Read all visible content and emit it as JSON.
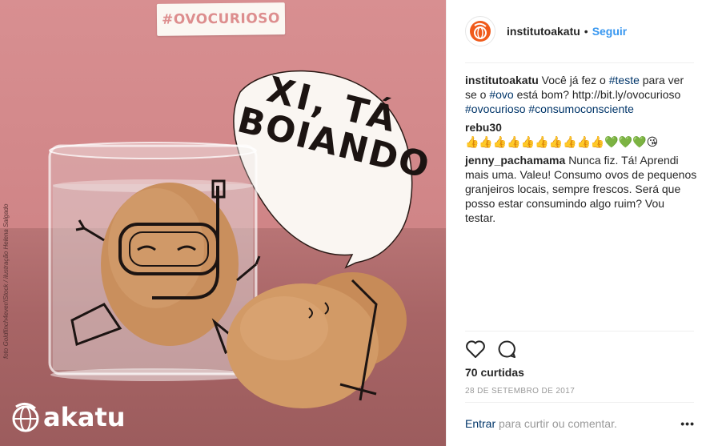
{
  "image": {
    "hashtag_banner": "#OVOCURIOSO",
    "side_credit": "foto Goldfinch4ever/iStock / ilustração Helena Salgado",
    "bubble_line1": "XI, TÁ",
    "bubble_line2": "BOIANDO",
    "brand_name": "akatu"
  },
  "post": {
    "author": "institutoakatu",
    "dot": "•",
    "follow_label": "Seguir",
    "caption": {
      "user": "institutoakatu",
      "t1": "Você já fez o ",
      "tag1": "#teste",
      "t2": " para ver se o ",
      "tag2": "#ovo",
      "t3": " está bom? http://bit.ly/ovocurioso ",
      "tag3": "#ovocurioso",
      "t4": " ",
      "tag4": "#consumoconsciente"
    },
    "comments": [
      {
        "user": "rebu30",
        "text": "👍👍👍👍👍👍👍👍👍👍💚💚💚😘"
      },
      {
        "user": "jenny_pachamama",
        "text": "Nunca fiz. Tá! Aprendi mais uma. Valeu! Consumo ovos de pequenos granjeiros locais, sempre frescos. Será que posso estar consumindo algo ruim? Vou testar."
      }
    ],
    "likes": "70 curtidas",
    "date": "28 DE SETEMBRO DE 2017",
    "login_link": "Entrar",
    "login_text": " para curtir ou comentar.",
    "more_label": "•••"
  },
  "colors": {
    "accent": "#3897f0",
    "link": "#003569",
    "brand_orange": "#f05a1a",
    "banner_text": "#dd8e8e"
  }
}
